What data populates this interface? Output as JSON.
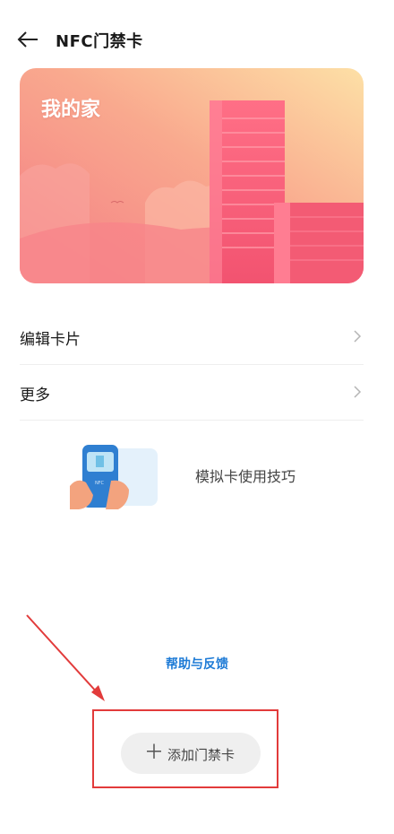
{
  "header": {
    "title": "NFC门禁卡",
    "back_icon": "arrow-left-icon"
  },
  "card": {
    "name": "我的家"
  },
  "menu": {
    "items": [
      {
        "label": "编辑卡片",
        "icon": "chevron-right-icon"
      },
      {
        "label": "更多",
        "icon": "chevron-right-icon"
      }
    ]
  },
  "tip": {
    "label": "模拟卡使用技巧",
    "icon": "phone-card-illustration"
  },
  "help": {
    "label": "帮助与反馈"
  },
  "add_button": {
    "plus": "＋",
    "label": "添加门禁卡",
    "icon": "plus-icon"
  },
  "colors": {
    "accent_link": "#1e7bd6",
    "annotation_red": "#e23b3b",
    "card_gradient_start": "#f58a8a",
    "card_gradient_end": "#fde3a8"
  }
}
